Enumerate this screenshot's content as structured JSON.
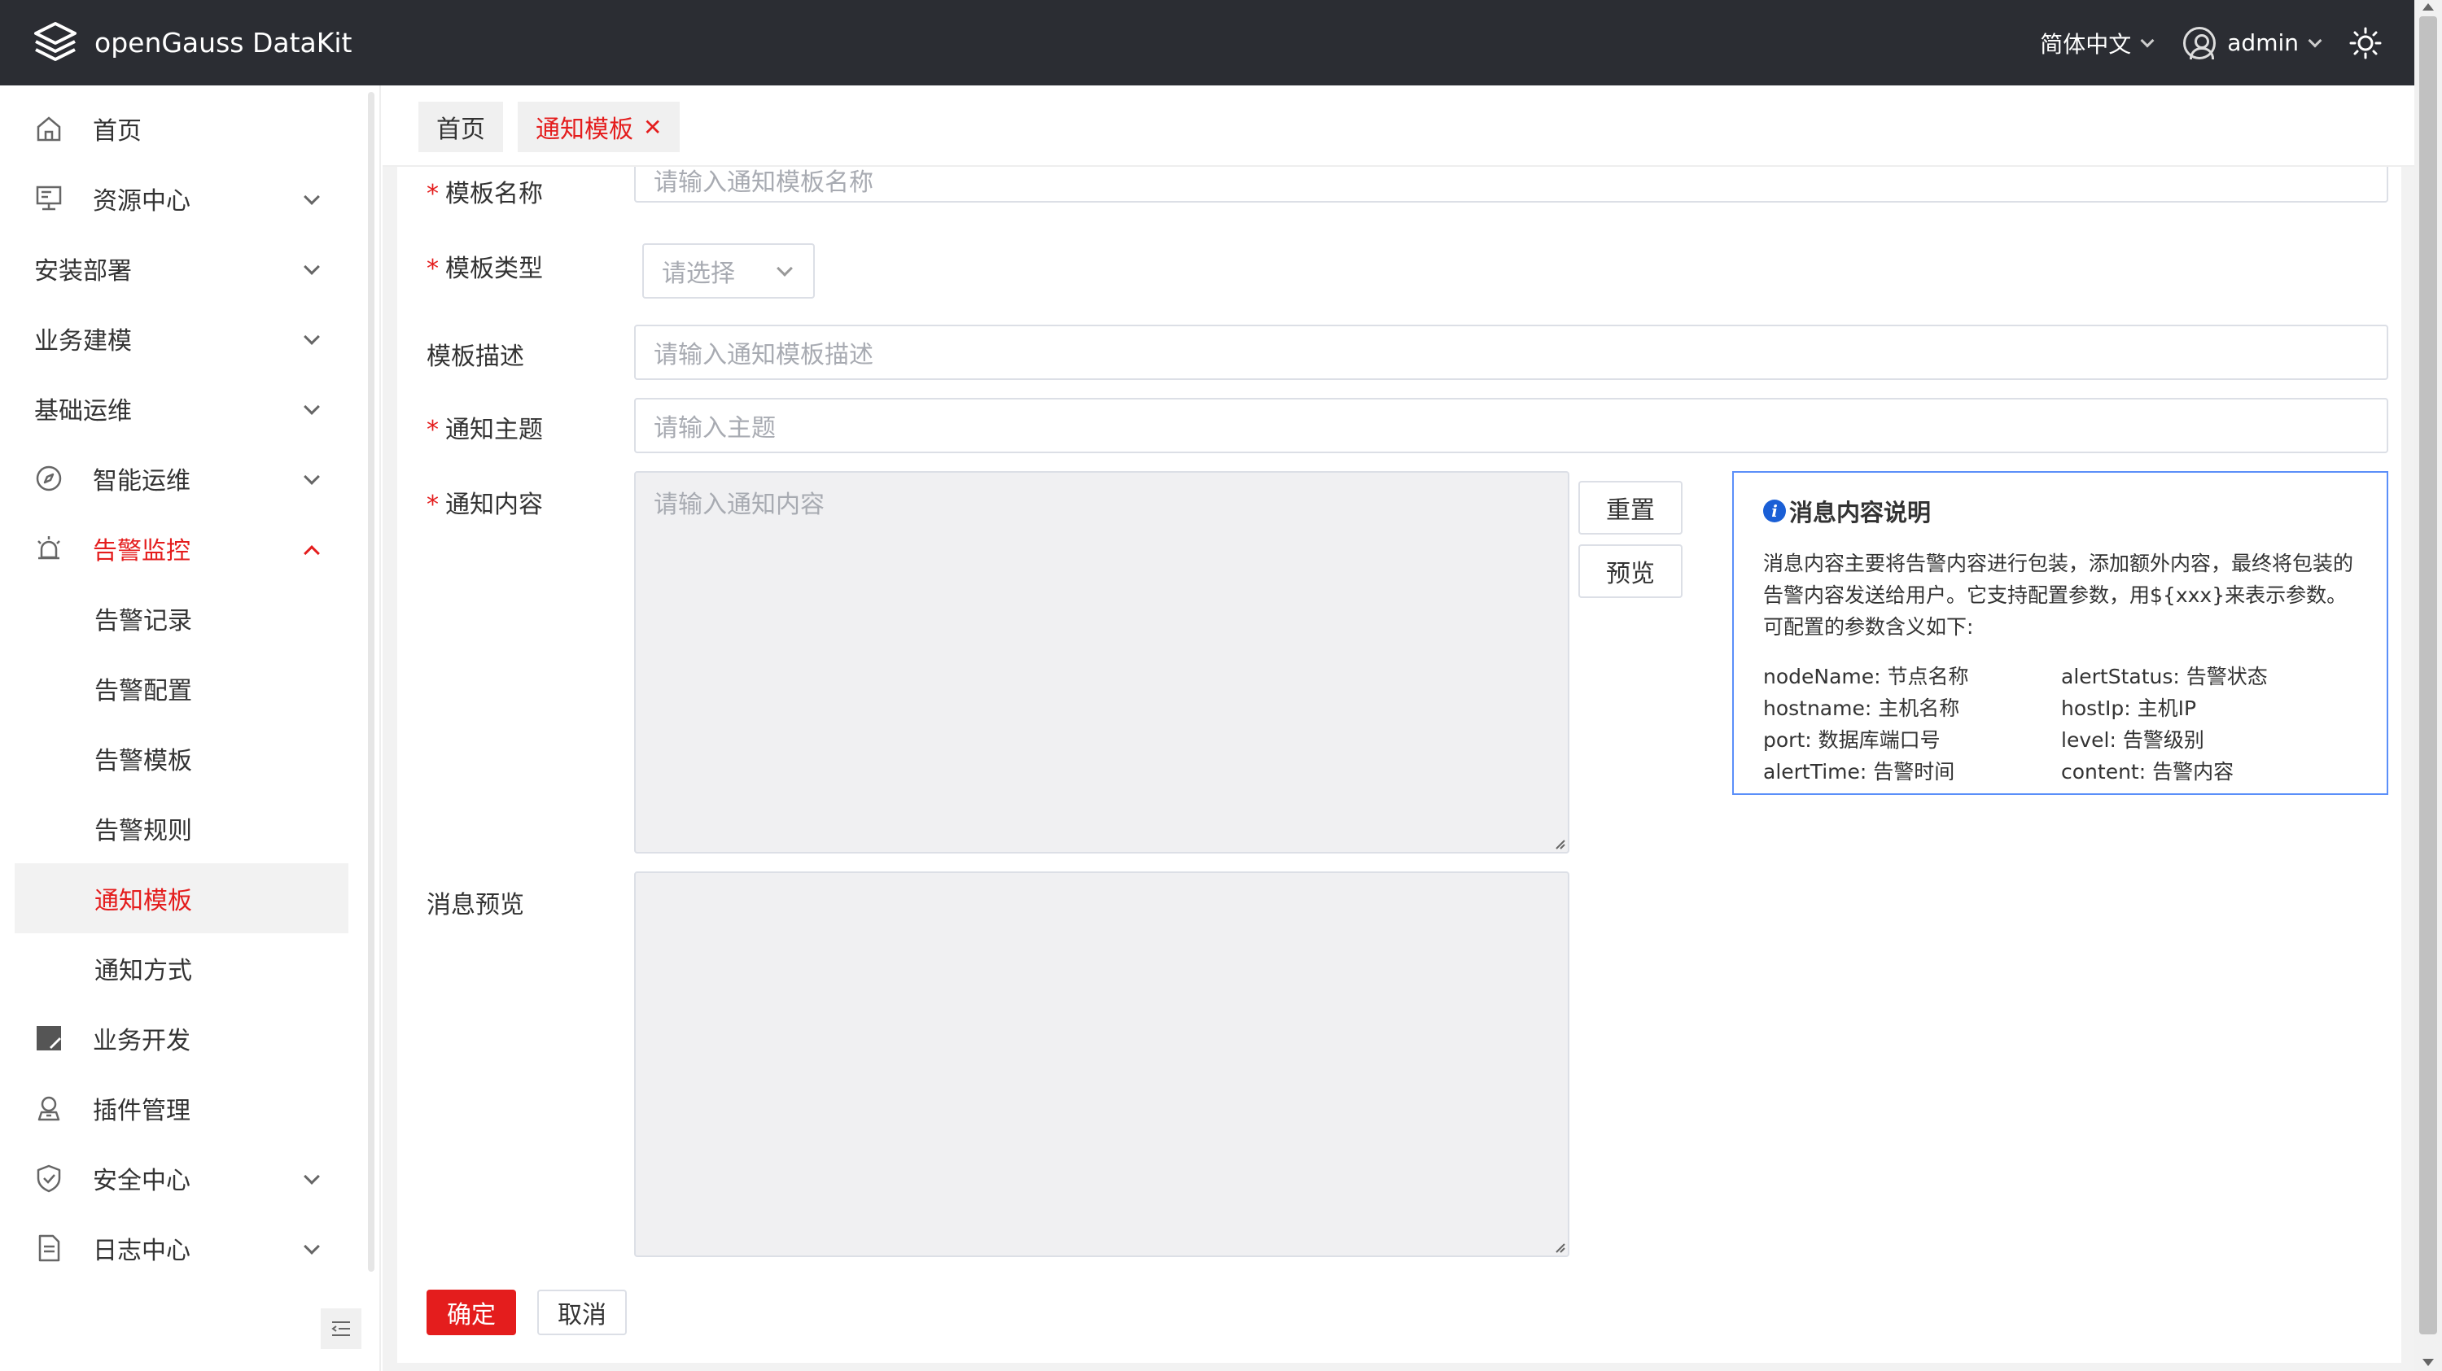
{
  "header": {
    "app_title": "openGauss DataKit",
    "language": "简体中文",
    "user": "admin"
  },
  "sidebar": {
    "items": [
      {
        "label": "首页",
        "icon": "home-icon"
      },
      {
        "label": "资源中心",
        "icon": "monitor-icon"
      },
      {
        "label": "安装部署"
      },
      {
        "label": "业务建模"
      },
      {
        "label": "基础运维"
      },
      {
        "label": "智能运维",
        "icon": "compass-icon"
      },
      {
        "label": "告警监控",
        "icon": "alarm-icon"
      },
      {
        "label": "业务开发",
        "icon": "edit-icon"
      },
      {
        "label": "插件管理",
        "icon": "plugin-icon"
      },
      {
        "label": "安全中心",
        "icon": "shield-icon"
      },
      {
        "label": "日志中心",
        "icon": "document-icon"
      }
    ],
    "sub_items": [
      "告警记录",
      "告警配置",
      "告警模板",
      "告警规则",
      "通知模板",
      "通知方式"
    ]
  },
  "tabs": [
    {
      "label": "首页"
    },
    {
      "label": "通知模板",
      "close": "✕"
    }
  ],
  "form": {
    "name": {
      "label": "模板名称",
      "placeholder": "请输入通知模板名称"
    },
    "type": {
      "label": "模板类型",
      "placeholder": "请选择"
    },
    "desc": {
      "label": "模板描述",
      "placeholder": "请输入通知模板描述"
    },
    "subject": {
      "label": "通知主题",
      "placeholder": "请输入主题"
    },
    "content": {
      "label": "通知内容",
      "placeholder": "请输入通知内容"
    },
    "preview": {
      "label": "消息预览"
    },
    "required_mark": "*",
    "reset_button": "重置",
    "preview_button": "预览",
    "confirm_button": "确定",
    "cancel_button": "取消"
  },
  "info": {
    "title": "消息内容说明",
    "description": "消息内容主要将告警内容进行包装，添加额外内容，最终将包装的告警内容发送给用户。它支持配置参数，用${xxx}来表示参数。可配置的参数含义如下:",
    "params": [
      "nodeName: 节点名称",
      "alertStatus: 告警状态",
      "hostname: 主机名称",
      "hostIp: 主机IP",
      "port: 数据库端口号",
      "level: 告警级别",
      "alertTime: 告警时间",
      "content: 告警内容"
    ]
  },
  "colors": {
    "accent": "#e41d1d",
    "header_bg": "#2b2d33",
    "info_border": "#5b8ff9"
  }
}
